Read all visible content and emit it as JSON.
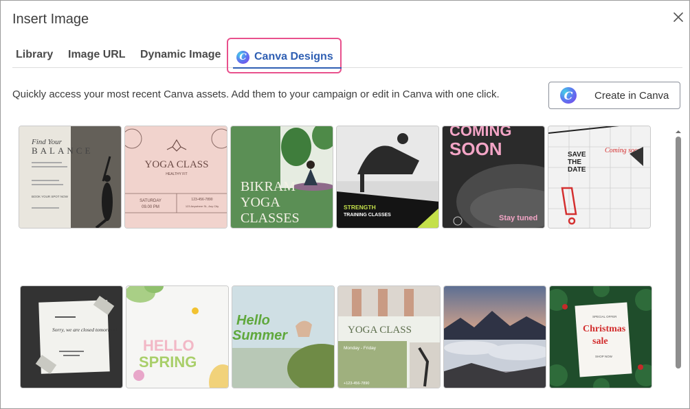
{
  "dialog": {
    "title": "Insert Image",
    "close_icon": "close-icon"
  },
  "tabs": [
    {
      "label": "Library"
    },
    {
      "label": "Image URL"
    },
    {
      "label": "Dynamic Image"
    },
    {
      "label": "Canva Designs",
      "active": true,
      "icon": "canva-logo-icon"
    }
  ],
  "intro_text": "Quickly access your most recent Canva assets. Add them to your campaign or edit in Canva with one click.",
  "create_button": {
    "label": "Create in Canva",
    "icon": "canva-logo-icon"
  },
  "colors": {
    "accent": "#2f5fb3",
    "highlight_border": "#e8508c"
  },
  "designs": [
    {
      "name": "find-your-balance",
      "texts": [
        "Find Your",
        "BALANCE",
        "BOOK YOUR SPOT NOW"
      ]
    },
    {
      "name": "yoga-class-pink",
      "texts": [
        "YOGA CLASS",
        "HEALTHY FIT",
        "SATURDAY",
        "09.00 PM",
        "123-456-7890",
        "123 Anywhere St., Any City"
      ]
    },
    {
      "name": "bikram-yoga",
      "texts": [
        "BIKRAM",
        "YOGA",
        "CLASSES"
      ]
    },
    {
      "name": "strength-training",
      "texts": [
        "STRENGTH",
        "TRAINING CLASSES"
      ]
    },
    {
      "name": "coming-soon",
      "texts": [
        "COMING",
        "SOON",
        "Stay tuned"
      ]
    },
    {
      "name": "save-the-date",
      "texts": [
        "SAVE",
        "THE",
        "DATE",
        "Coming soon"
      ]
    },
    {
      "name": "sorry-we-are-closed",
      "texts": [
        "Sorry, we are closed tomorrow!"
      ]
    },
    {
      "name": "hello-spring",
      "texts": [
        "HELLO",
        "SPRING"
      ]
    },
    {
      "name": "hello-summer",
      "texts": [
        "Hello",
        "Summer"
      ]
    },
    {
      "name": "yoga-class-green",
      "texts": [
        "YOGA CLASS",
        "Monday - Friday",
        "+123-456-7890"
      ]
    },
    {
      "name": "mountain-sunset",
      "texts": []
    },
    {
      "name": "christmas-sale",
      "texts": [
        "SPECIAL OFFER",
        "Christmas",
        "sale",
        "SHOP NOW"
      ]
    }
  ]
}
